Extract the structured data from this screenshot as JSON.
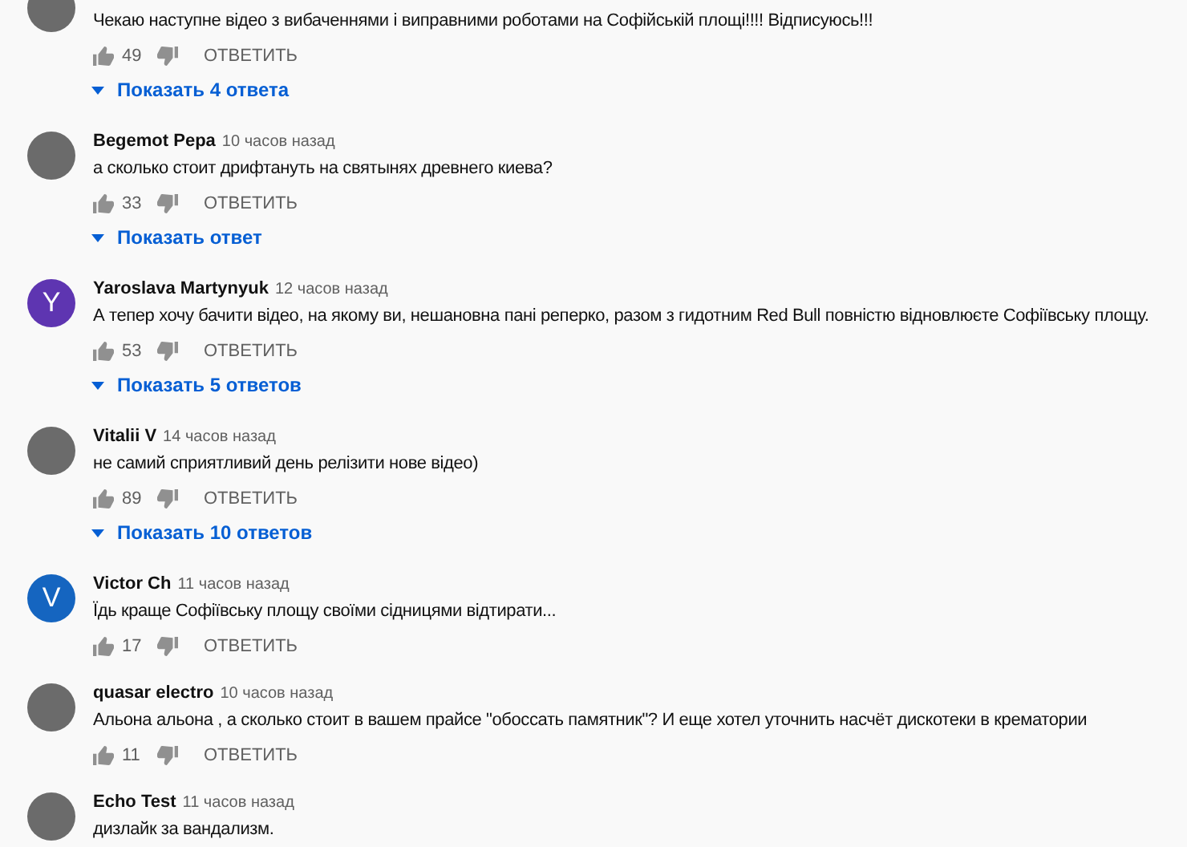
{
  "comments": [
    {
      "avatar": {
        "kind": "photo"
      },
      "text": "Чекаю наступне відео з вибаченнями і виправними роботами на Софійській площі!!!! Відписуюсь!!!",
      "likes": "49",
      "reply_label": "ОТВЕТИТЬ",
      "replies": "Показать 4 ответа"
    },
    {
      "avatar": {
        "kind": "photo"
      },
      "author": "Begemot Pepa",
      "time": "10 часов назад",
      "text": "а сколько стоит дрифтануть на святынях древнего киева?",
      "likes": "33",
      "reply_label": "ОТВЕТИТЬ",
      "replies": "Показать ответ"
    },
    {
      "avatar": {
        "kind": "letter",
        "letter": "Y",
        "color": "#5e35b1"
      },
      "author": "Yaroslava Martynyuk",
      "time": "12 часов назад",
      "text": "А тепер хочу бачити відео, на якому ви, нешановна пані реперко, разом з гидотним Red Bull повністю відновлюєте Софіївську площу.",
      "likes": "53",
      "reply_label": "ОТВЕТИТЬ",
      "replies": "Показать 5 ответов"
    },
    {
      "avatar": {
        "kind": "photo"
      },
      "author": "Vitalii V",
      "time": "14 часов назад",
      "text": "не самий сприятливий день релізити нове відео)",
      "likes": "89",
      "reply_label": "ОТВЕТИТЬ",
      "replies": "Показать 10 ответов"
    },
    {
      "avatar": {
        "kind": "letter",
        "letter": "V",
        "color": "#1565c0"
      },
      "author": "Victor Ch",
      "time": "11 часов назад",
      "text": "Їдь краще Софіївську площу своїми сідницями відтирати...",
      "likes": "17",
      "reply_label": "ОТВЕТИТЬ"
    },
    {
      "avatar": {
        "kind": "photo"
      },
      "author": "quasar electro",
      "time": "10 часов назад",
      "text": "Альона альона , а сколько стоит в вашем прайсе \"обоссать памятник\"? И еще хотел уточнить насчёт дискотеки в крематории",
      "likes": "11",
      "reply_label": "ОТВЕТИТЬ"
    },
    {
      "avatar": {
        "kind": "photo"
      },
      "author": "Echo Test",
      "time": "11 часов назад",
      "text": "дизлайк за вандализм."
    }
  ]
}
